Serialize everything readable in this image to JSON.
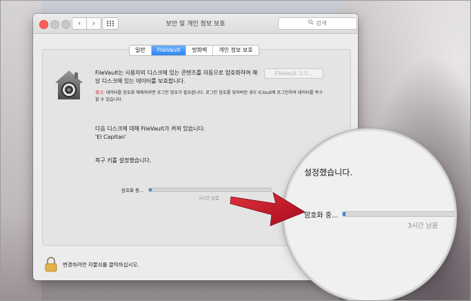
{
  "window": {
    "title": "보안 및 개인 정보 보호",
    "search_placeholder": "검색",
    "back_glyph": "‹",
    "forward_glyph": "›"
  },
  "tabs": [
    {
      "label": "일반",
      "active": false
    },
    {
      "label": "FileVault",
      "active": true
    },
    {
      "label": "방화벽",
      "active": false
    },
    {
      "label": "개인 정보 보호",
      "active": false
    }
  ],
  "filevault": {
    "description": "FileVault는 사용자의 디스크에 있는 콘텐츠를 자동으로 암호화하여 해당 디스크에 있는 데이터를 보호합니다.",
    "turn_off_button": "FileVault 끄기...",
    "warning_label": "경고:",
    "warning_text": "데이터를 암호화 해제하려면 로그인 암호가 필요합니다. 로그인 암호를 잊어버린 경우 iCloud에 로그인하여 데이터를 복구할 수 있습니다.",
    "status_line1": "다음 디스크에 대해 FileVault가 켜져 있습니다:",
    "status_line2": "'El Capitan'",
    "recovery_status": "복구 키를 설정했습니다.",
    "encrypting_label": "암호화 중...",
    "progress_fraction": 0.02,
    "time_remaining": "3시간 남음"
  },
  "footer": {
    "lock_text": "변경하려면 자물쇠를 클릭하십시오."
  },
  "magnifier": {
    "title": "설정했습니다.",
    "encrypting_label": "암호화 중...",
    "time_remaining": "3시간 남음"
  },
  "icons": [
    "search-icon",
    "lock-house-icon",
    "padlock-icon",
    "grid-icon",
    "red-arrow-icon"
  ],
  "colors": {
    "accent": "#3b88ee",
    "warning": "#d0021b",
    "arrow": "#c8102e"
  }
}
